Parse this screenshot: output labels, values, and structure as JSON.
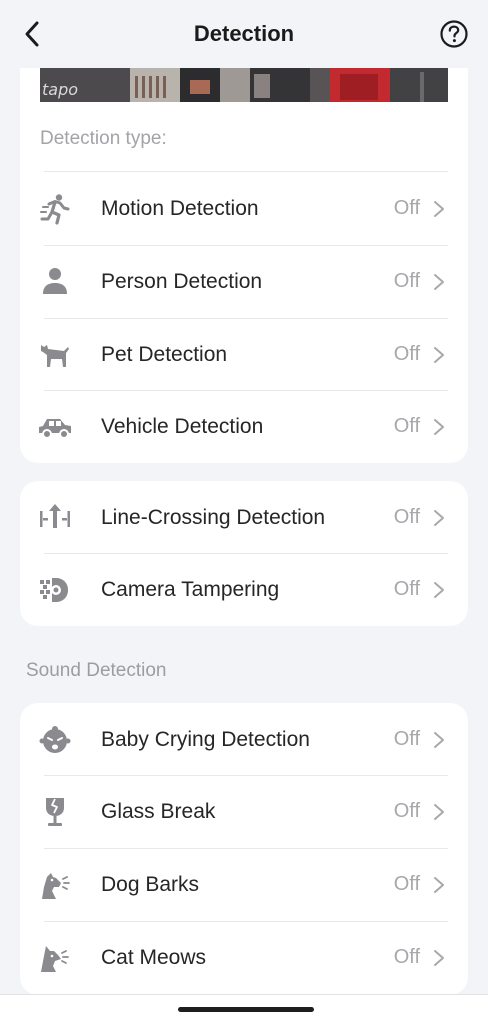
{
  "header": {
    "title": "Detection",
    "back_icon": "chevron-left-icon",
    "help_icon": "question-circle-icon"
  },
  "preview": {
    "logo_text": "tapo"
  },
  "detection_type": {
    "heading": "Detection type:",
    "items": [
      {
        "label": "Motion Detection",
        "status": "Off",
        "icon": "running-person-icon"
      },
      {
        "label": "Person Detection",
        "status": "Off",
        "icon": "person-icon"
      },
      {
        "label": "Pet Detection",
        "status": "Off",
        "icon": "dog-icon"
      },
      {
        "label": "Vehicle Detection",
        "status": "Off",
        "icon": "car-icon"
      }
    ]
  },
  "advanced": {
    "items": [
      {
        "label": "Line-Crossing Detection",
        "status": "Off",
        "icon": "line-crossing-icon"
      },
      {
        "label": "Camera Tampering",
        "status": "Off",
        "icon": "camera-tampering-icon"
      }
    ]
  },
  "sound_detection": {
    "heading": "Sound Detection",
    "items": [
      {
        "label": "Baby Crying Detection",
        "status": "Off",
        "icon": "baby-crying-icon"
      },
      {
        "label": "Glass Break",
        "status": "Off",
        "icon": "glass-break-icon"
      },
      {
        "label": "Dog Barks",
        "status": "Off",
        "icon": "dog-bark-icon"
      },
      {
        "label": "Cat Meows",
        "status": "Off",
        "icon": "cat-meow-icon"
      }
    ]
  },
  "colors": {
    "background": "#f3f4f8",
    "card": "#ffffff",
    "icon": "#8a8a8f",
    "secondary_text": "#a8a8ac"
  }
}
